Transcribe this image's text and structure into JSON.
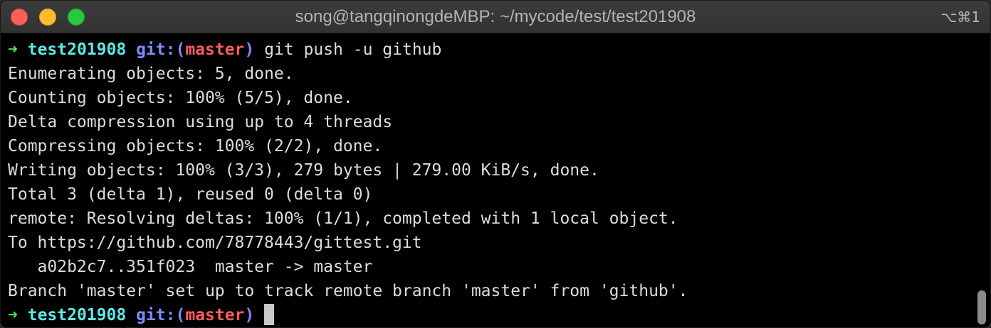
{
  "window": {
    "title": "song@tangqinongdeMBP: ~/mycode/test/test201908",
    "shortcut": "⌥⌘1"
  },
  "prompt": {
    "arrow": "➜",
    "directory": "test201908",
    "git_prefix": "git:(",
    "branch": "master",
    "git_suffix": ")"
  },
  "command": "git push -u github",
  "output": [
    "Enumerating objects: 5, done.",
    "Counting objects: 100% (5/5), done.",
    "Delta compression using up to 4 threads",
    "Compressing objects: 100% (2/2), done.",
    "Writing objects: 100% (3/3), 279 bytes | 279.00 KiB/s, done.",
    "Total 3 (delta 1), reused 0 (delta 0)",
    "remote: Resolving deltas: 100% (1/1), completed with 1 local object.",
    "To https://github.com/78778443/gittest.git",
    "   a02b2c7..351f023  master -> master",
    "Branch 'master' set up to track remote branch 'master' from 'github'."
  ],
  "colors": {
    "arrow": "#4ee44e",
    "directory": "#5fe8e8",
    "git": "#7c8cff",
    "branch": "#ff5c5c",
    "text": "#dcdcdc",
    "background": "#000000"
  }
}
